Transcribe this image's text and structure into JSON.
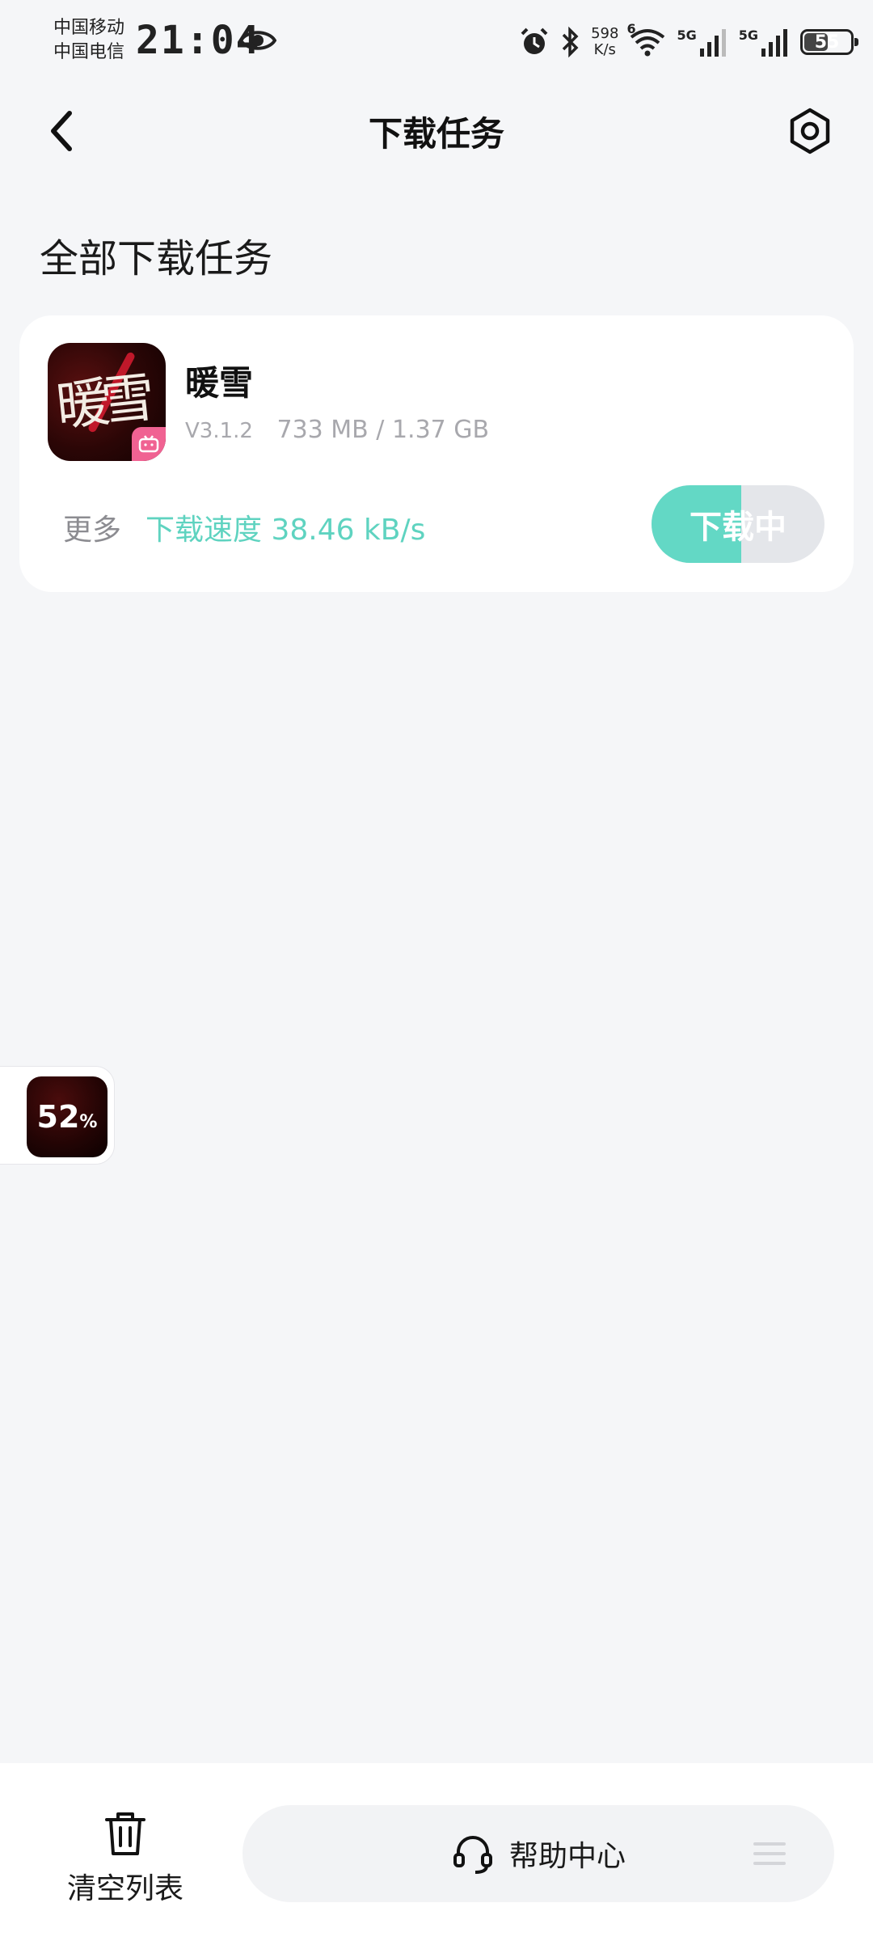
{
  "status_bar": {
    "carrier_1": "中国移动",
    "carrier_2": "中国电信",
    "time": "21:04",
    "net_speed_value": "598",
    "net_speed_unit": "K/s",
    "sim1_tag": "5G",
    "sim2_tag": "5G",
    "wifi_tag": "6",
    "battery": "55",
    "icons": [
      "eye-icon",
      "alarm-icon",
      "bluetooth-icon",
      "wifi-icon",
      "signal-icon",
      "battery-icon"
    ]
  },
  "header": {
    "title": "下载任务",
    "back_icon": "chevron-left-icon",
    "settings_icon": "hexagon-settings-icon"
  },
  "section": {
    "title": "全部下载任务"
  },
  "task": {
    "app_name": "暖雪",
    "version": "V3.1.2",
    "size_progress": "733 MB / 1.37 GB",
    "more_label": "更多",
    "speed_text": "下载速度 38.46 kB/s",
    "button_label": "下载中",
    "progress_fraction": 0.52,
    "accent_color": "#63d8c5"
  },
  "float_widget": {
    "percent_value": "52",
    "percent_sign": "%"
  },
  "bottom_bar": {
    "clear_label": "清空列表",
    "help_label": "帮助中心",
    "clear_icon": "trash-icon",
    "help_icon": "headset-icon",
    "menu_icon": "menu-icon"
  }
}
